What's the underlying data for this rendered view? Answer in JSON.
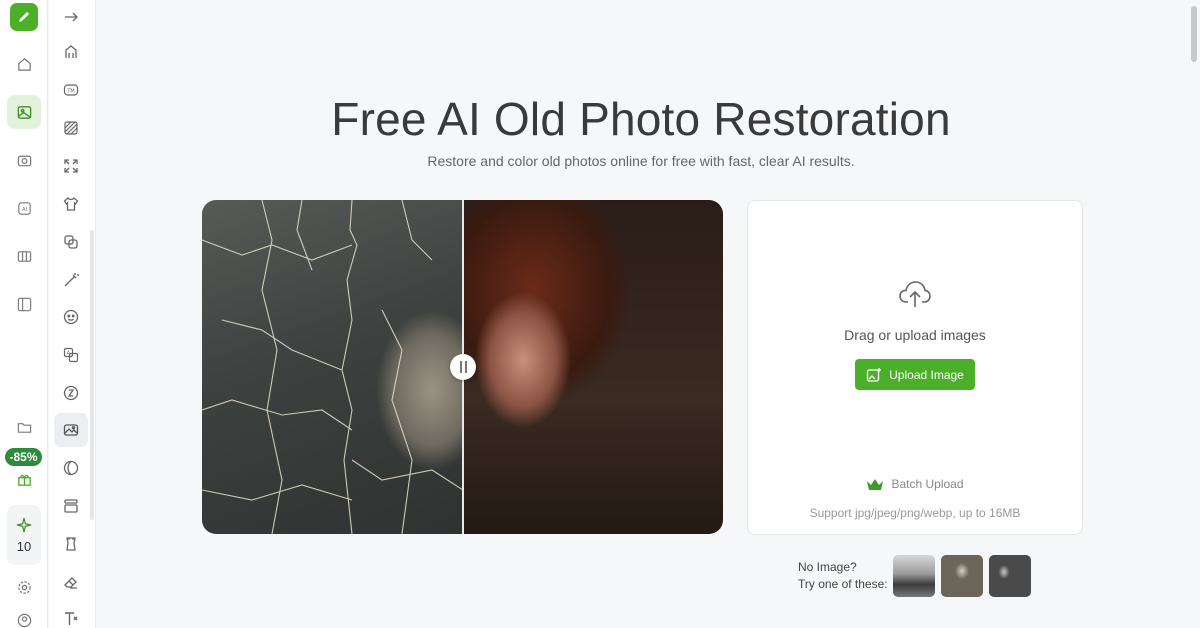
{
  "rail": {
    "discount_badge": "-85%",
    "credits": "10"
  },
  "main": {
    "title": "Free AI Old Photo Restoration",
    "subtitle": "Restore and color old photos online for free with fast, clear AI results."
  },
  "upload": {
    "drag_text": "Drag or upload images",
    "button_label": "Upload Image",
    "batch_label": "Batch Upload",
    "support_text": "Support jpg/jpeg/png/webp, up to 16MB"
  },
  "samples": {
    "line1": "No Image?",
    "line2": "Try one of these:"
  },
  "colors": {
    "accent": "#4caf2a",
    "badge": "#2e8b3a"
  }
}
